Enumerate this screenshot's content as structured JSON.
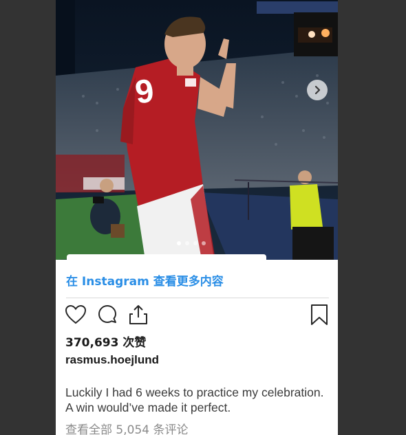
{
  "post": {
    "view_more_label": "在 Instagram 查看更多内容",
    "likes_text": "370,693 次赞",
    "username": "rasmus.hoejlund",
    "caption": "Luckily I had 6 weeks to practice my celebration. A win would’ve made it perfect.",
    "comments_text": "查看全部 5,054 条评论",
    "carousel": {
      "slide_count": 4,
      "active_index": 0
    },
    "jersey_number": "9"
  },
  "icons": {
    "like": "heart-icon",
    "comment": "comment-icon",
    "share": "share-icon",
    "save": "bookmark-icon",
    "next": "chevron-right-icon"
  },
  "colors": {
    "link_blue": "#2a8ee6",
    "page_background": "#333333",
    "jersey_red": "#b51d24"
  }
}
